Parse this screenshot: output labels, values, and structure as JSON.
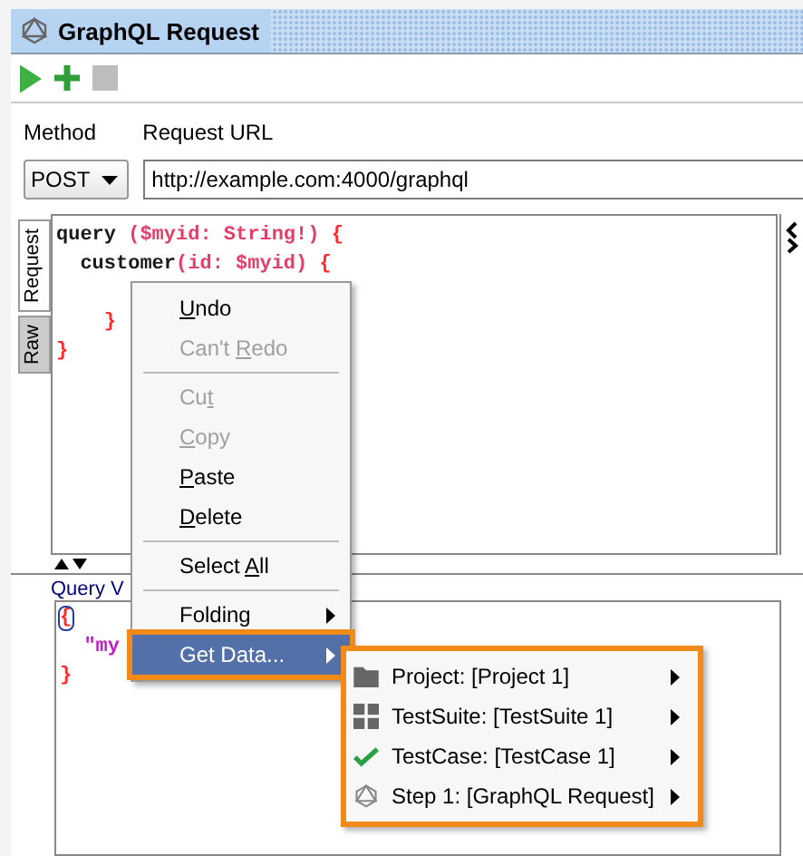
{
  "window": {
    "title": "GraphQL Request"
  },
  "toolbar": [
    {
      "kind": "run",
      "disabled": false
    },
    {
      "kind": "add",
      "disabled": false
    },
    {
      "kind": "stop",
      "disabled": true
    }
  ],
  "form": {
    "method_label": "Method",
    "method": "POST",
    "url_label": "Request URL",
    "url": "http://example.com:4000/graphql"
  },
  "editor_tabs": [
    {
      "label": "Request",
      "selected": true
    },
    {
      "label": "Raw",
      "selected": false
    }
  ],
  "request_editor": {
    "lines": [
      {
        "tokens": [
          {
            "text": "query ",
            "kind": "keyword"
          },
          {
            "text": "($myid: String!) ",
            "kind": "args"
          },
          {
            "text": "{",
            "kind": "brace"
          }
        ]
      },
      {
        "tokens": [
          {
            "text": "  customer",
            "kind": "keyword"
          },
          {
            "text": "(id: $myid) ",
            "kind": "args"
          },
          {
            "text": "{",
            "kind": "brace"
          }
        ]
      },
      {
        "tokens": [
          {
            "text": "    }",
            "kind": "brace"
          }
        ]
      },
      {
        "tokens": [
          {
            "text": "}",
            "kind": "brace"
          }
        ]
      }
    ]
  },
  "variables_label": "Query V",
  "variables_editor": {
    "lines": [
      {
        "tokens": [
          {
            "text": "{",
            "kind": "brace",
            "bracket_match": true
          }
        ]
      },
      {
        "tokens": [
          {
            "text": "  \"my",
            "kind": "string",
            "bracket_match": false
          }
        ]
      },
      {
        "tokens": [
          {
            "text": "}",
            "kind": "brace",
            "bracket_match": false
          }
        ]
      }
    ]
  },
  "context_menu": {
    "items": [
      {
        "kind": "item",
        "key": "U",
        "post": "ndo",
        "disabled": false,
        "selected": false,
        "highlighted": false
      },
      {
        "kind": "item",
        "pre": "Can't ",
        "key": "R",
        "post": "edo",
        "disabled": true,
        "selected": false,
        "highlighted": false
      },
      {
        "kind": "separator"
      },
      {
        "kind": "item",
        "pre": "Cu",
        "key": "t",
        "disabled": true,
        "selected": false,
        "highlighted": false
      },
      {
        "kind": "item",
        "key": "C",
        "post": "opy",
        "disabled": true,
        "selected": false,
        "highlighted": false
      },
      {
        "kind": "item",
        "key": "P",
        "post": "aste",
        "disabled": false,
        "selected": false,
        "highlighted": false
      },
      {
        "kind": "item",
        "key": "D",
        "post": "elete",
        "disabled": false,
        "selected": false,
        "highlighted": false
      },
      {
        "kind": "separator"
      },
      {
        "kind": "item",
        "pre": "Select ",
        "key": "A",
        "post": "ll",
        "disabled": false,
        "selected": false,
        "highlighted": false
      },
      {
        "kind": "separator"
      },
      {
        "kind": "submenu",
        "pre": "Folding",
        "disabled": false,
        "selected": false,
        "highlighted": false
      },
      {
        "kind": "submenu",
        "pre": "Get Data...",
        "disabled": false,
        "selected": true,
        "highlighted": true
      }
    ]
  },
  "submenu": {
    "highlighted": true,
    "items": [
      {
        "kind": "folder",
        "label": "Project: [Project 1]"
      },
      {
        "kind": "grid",
        "label": "TestSuite: [TestSuite 1]"
      },
      {
        "kind": "check",
        "label": "TestCase: [TestCase 1]"
      },
      {
        "kind": "graphql",
        "label": "Step 1: [GraphQL Request]"
      }
    ]
  }
}
